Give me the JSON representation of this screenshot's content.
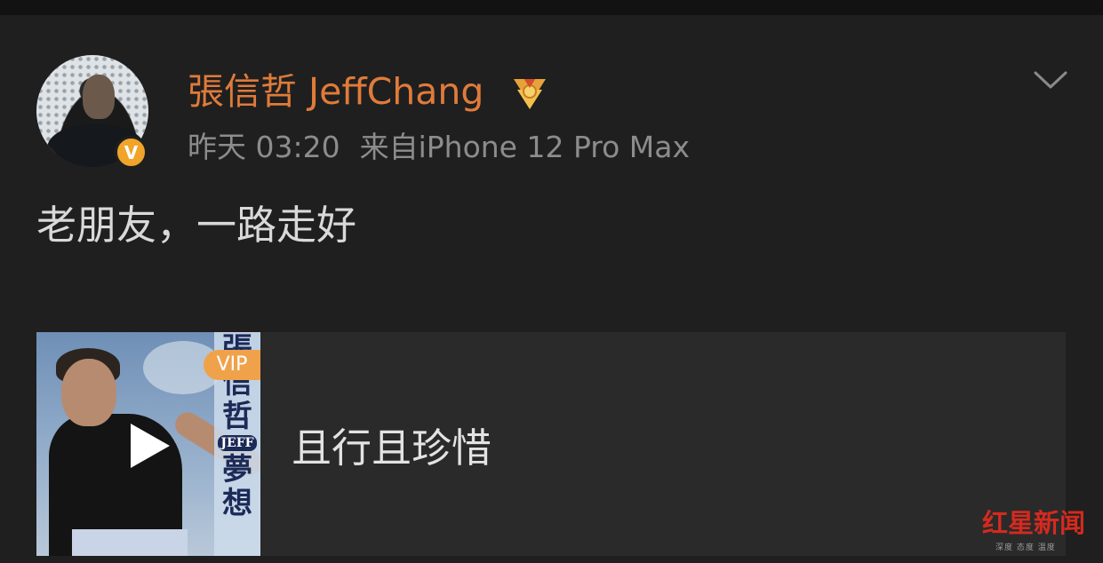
{
  "post": {
    "author": "張信哲 JeffChang",
    "verified_badge": "V",
    "time": "昨天 03:20",
    "source": "来自iPhone 12 Pro Max",
    "text": "老朋友，一路走好"
  },
  "music_card": {
    "vip_label": "VIP",
    "cover_artist_chars": "張信哲",
    "cover_name": "JEFF",
    "cover_album": "夢想",
    "song_title": "且行且珍惜"
  },
  "watermark": {
    "brand": "红星新闻",
    "tagline": "深度 态度 温度"
  },
  "icons": [
    "verified-v-icon",
    "medal-icon",
    "chevron-down-icon",
    "play-icon"
  ],
  "colors": {
    "background": "#1f1f1f",
    "username": "#e07b3a",
    "meta": "#8c8c8c",
    "body_text": "#d9d9d9",
    "card": "#2a2a2a",
    "vip": "#f0a24a",
    "verified": "#f0a52a",
    "watermark": "#d42a1f"
  }
}
